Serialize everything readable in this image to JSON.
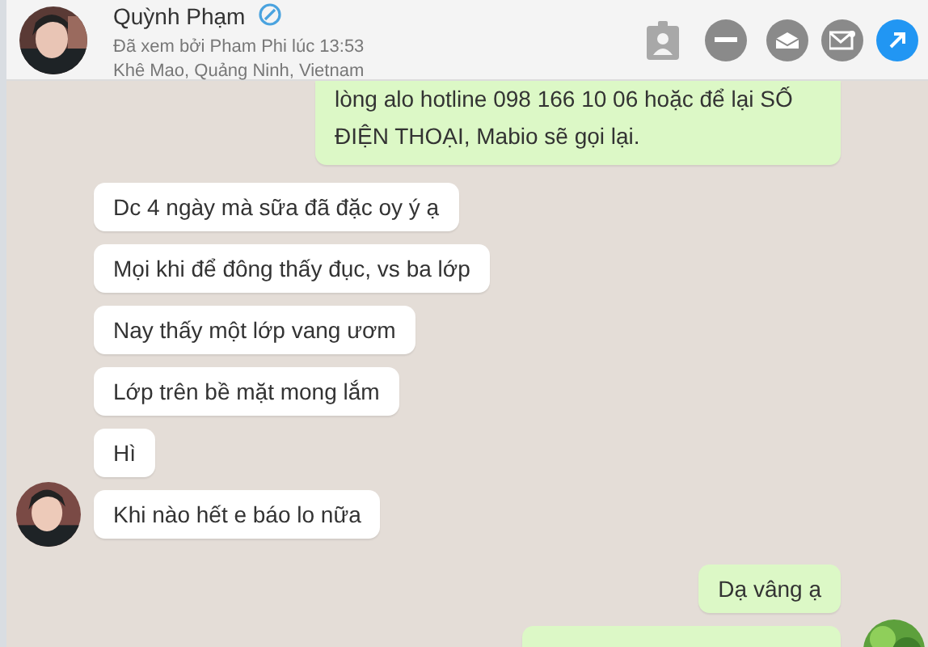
{
  "contact": {
    "name": "Quỳnh Phạm",
    "seen": "Đã xem bởi Pham Phi lúc 13:53",
    "location": "Khê Mao, Quảng Ninh, Vietnam",
    "verified": true
  },
  "messages": [
    {
      "kind": "outgoing",
      "text": "lòng alo hotline 098 166 10 06 hoặc để lại SỐ ĐIỆN THOẠI, Mabio sẽ gọi lại.",
      "avatar": false
    },
    {
      "kind": "incoming",
      "text": "Dc 4 ngày mà sữa đã đặc oy ý ạ",
      "avatar": false
    },
    {
      "kind": "incoming",
      "text": "Mọi khi để đông thấy đục, vs ba lớp",
      "avatar": false
    },
    {
      "kind": "incoming",
      "text": "Nay thấy một lớp vang ươm",
      "avatar": false
    },
    {
      "kind": "incoming",
      "text": "Lớp trên bề mặt mong lắm",
      "avatar": false
    },
    {
      "kind": "incoming",
      "text": "Hì",
      "avatar": false
    },
    {
      "kind": "incoming",
      "text": "Khi nào hết e báo lo nữa",
      "avatar": true
    },
    {
      "kind": "outgoing",
      "text": "Dạ vâng ạ",
      "avatar": false
    },
    {
      "kind": "outgoing",
      "avatar": true
    }
  ]
}
